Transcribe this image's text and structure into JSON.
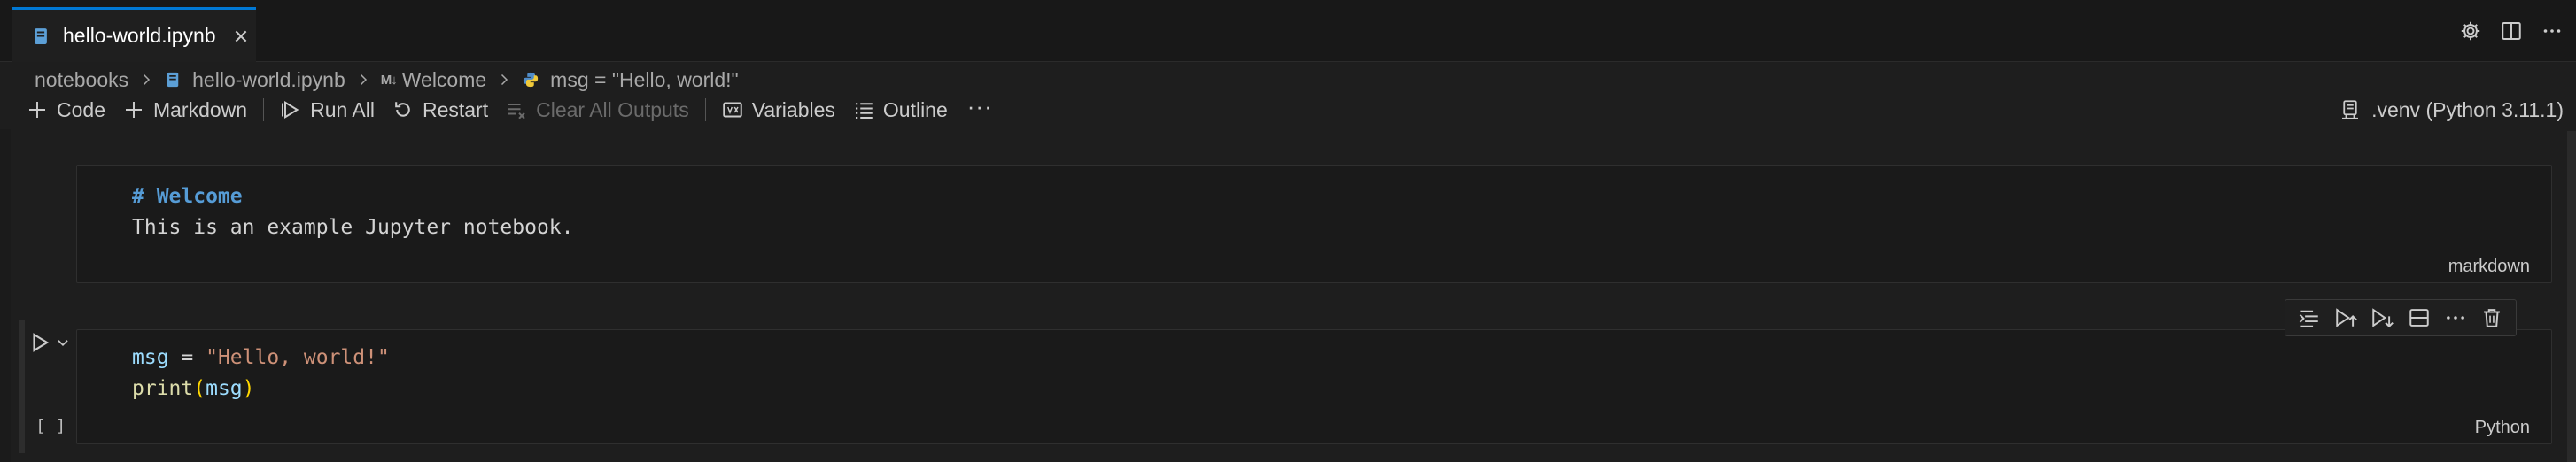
{
  "tab": {
    "label": "hello-world.ipynb",
    "icons": {
      "file": "notebook-file-icon",
      "close": "close-icon"
    }
  },
  "editor_actions": {
    "icons": [
      "gear-icon",
      "split-editor-icon",
      "more-actions-icon"
    ]
  },
  "breadcrumb": {
    "items": [
      {
        "label": "notebooks",
        "icon": null
      },
      {
        "label": "hello-world.ipynb",
        "icon": "notebook-file-icon"
      },
      {
        "label": "Welcome",
        "icon": "markdown-icon",
        "badge": "M↓"
      },
      {
        "label": "msg = \"Hello, world!\"",
        "icon": "python-icon"
      }
    ]
  },
  "toolbar": {
    "code_label": "Code",
    "markdown_label": "Markdown",
    "run_all_label": "Run All",
    "restart_label": "Restart",
    "clear_outputs_label": "Clear All Outputs",
    "variables_label": "Variables",
    "outline_label": "Outline",
    "more_label": "···"
  },
  "kernel": {
    "label": ".venv (Python 3.11.1)"
  },
  "cells": [
    {
      "type": "markdown",
      "lines": [
        "# Welcome",
        "This is an example Jupyter notebook."
      ],
      "lang_label": "markdown"
    },
    {
      "type": "code",
      "tokens_line1": {
        "var": "msg",
        "op": " = ",
        "str": "\"Hello, world!\""
      },
      "tokens_line2": {
        "fn": "print",
        "open": "(",
        "arg": "msg",
        "close": ")"
      },
      "lang_label": "Python",
      "exec_count": "[ ]"
    }
  ],
  "cell_toolbar": {
    "icons": [
      "execute-above-icon",
      "execute-and-above-icon",
      "execute-and-below-icon",
      "split-cell-icon",
      "more-icon",
      "delete-icon"
    ]
  },
  "colors": {
    "accent": "#0078d4",
    "md_heading": "#569cd6",
    "string": "#ce9178",
    "variable": "#9cdcfe",
    "function": "#dcdcaa"
  }
}
